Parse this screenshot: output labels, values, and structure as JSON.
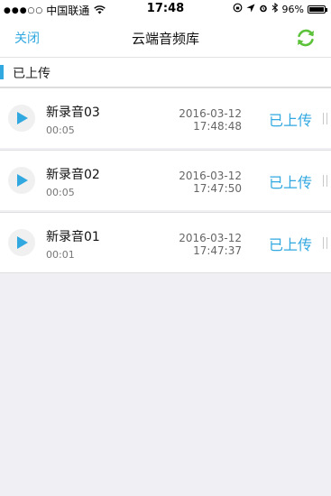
{
  "status_bar": {
    "signal": "●●●○○",
    "carrier": "中国联通",
    "time": "17:48",
    "battery": "96%"
  },
  "nav": {
    "close_label": "关闭",
    "title": "云端音频库",
    "refresh_icon": "refresh-icon"
  },
  "section": {
    "title": "已上传"
  },
  "recordings": [
    {
      "name": "新录音03",
      "duration": "00:05",
      "date": "2016-03-12",
      "time": "17:48:48",
      "status": "已上传"
    },
    {
      "name": "新录音02",
      "duration": "00:05",
      "date": "2016-03-12",
      "time": "17:47:50",
      "status": "已上传"
    },
    {
      "name": "新录音01",
      "duration": "00:01",
      "date": "2016-03-12",
      "time": "17:47:37",
      "status": "已上传"
    }
  ],
  "colors": {
    "accent": "#32a8e0",
    "refresh_green": "#5cc23a",
    "background": "#efeff4"
  }
}
